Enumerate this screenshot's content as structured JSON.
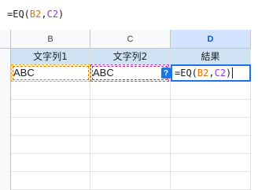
{
  "formula_bar": {
    "prefix": "=EQ(",
    "ref1": "B2",
    "comma": ",",
    "ref2": "C2",
    "suffix": ")"
  },
  "columns": [
    "B",
    "C",
    "D"
  ],
  "selected_column": "D",
  "headers": [
    "文字列1",
    "文字列2",
    "結果"
  ],
  "row2": {
    "b": "ABC",
    "c": "ABC",
    "d_prefix": "=EQ(",
    "d_ref1": "B2",
    "d_comma": ",",
    "d_ref2": "C2",
    "d_suffix": ")"
  },
  "help_chip": "?",
  "colors": {
    "ref1": "#e37400",
    "ref2": "#9334e6",
    "header_fill": "#cfe2f3",
    "selection": "#1a73e8"
  }
}
